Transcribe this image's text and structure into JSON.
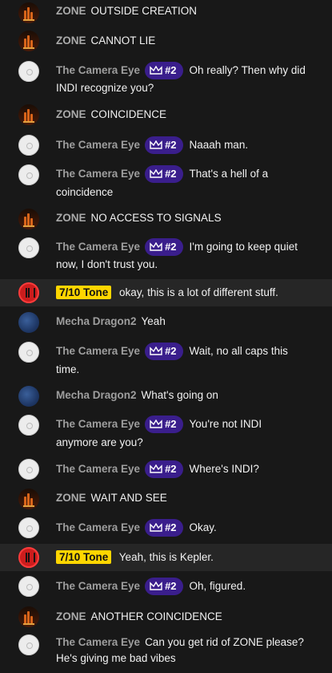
{
  "messages": [
    {
      "author": "ZONE",
      "avatar": "zone-avatar",
      "text": "OUTSIDE CREATION"
    },
    {
      "author": "ZONE",
      "avatar": "zone-avatar",
      "text": "CANNOT LIE"
    },
    {
      "author": "The Camera Eye",
      "avatar": "camera-eye-avatar",
      "badge": "#2",
      "text": "Oh really? Then why did",
      "text2": "INDI recognize you?"
    },
    {
      "author": "ZONE",
      "avatar": "zone-avatar",
      "text": "COINCIDENCE"
    },
    {
      "author": "The Camera Eye",
      "avatar": "camera-eye-avatar",
      "badge": "#2",
      "text": "Naaah man."
    },
    {
      "author": "The Camera Eye",
      "avatar": "camera-eye-avatar",
      "badge": "#2",
      "text": "That's a hell of a",
      "text2": "coincidence"
    },
    {
      "author": "ZONE",
      "avatar": "zone-avatar",
      "text": "NO ACCESS TO SIGNALS"
    },
    {
      "author": "The Camera Eye",
      "avatar": "camera-eye-avatar",
      "badge": "#2",
      "text": "I'm going to keep quiet",
      "text2": "now, I don't trust you."
    },
    {
      "author": "7/10 Tone",
      "avatar": "tone-avatar",
      "text": "okay, this is a lot of different stuff."
    },
    {
      "author": "Mecha Dragon2",
      "avatar": "mecha-dragon-avatar",
      "text": "Yeah"
    },
    {
      "author": "The Camera Eye",
      "avatar": "camera-eye-avatar",
      "badge": "#2",
      "text": "Wait, no all caps this",
      "text2": "time."
    },
    {
      "author": "Mecha Dragon2",
      "avatar": "mecha-dragon-avatar",
      "text": "What's going on"
    },
    {
      "author": "The Camera Eye",
      "avatar": "camera-eye-avatar",
      "badge": "#2",
      "text": "You're not INDI",
      "text2": "anymore are you?"
    },
    {
      "author": "The Camera Eye",
      "avatar": "camera-eye-avatar",
      "badge": "#2",
      "text": "Where's INDI?"
    },
    {
      "author": "ZONE",
      "avatar": "zone-avatar",
      "text": "WAIT AND SEE"
    },
    {
      "author": "The Camera Eye",
      "avatar": "camera-eye-avatar",
      "badge": "#2",
      "text": "Okay."
    },
    {
      "author": "7/10 Tone",
      "avatar": "tone-avatar",
      "text": "Yeah, this is Kepler."
    },
    {
      "author": "The Camera Eye",
      "avatar": "camera-eye-avatar",
      "badge": "#2",
      "text": "Oh, figured."
    },
    {
      "author": "ZONE",
      "avatar": "zone-avatar",
      "text": "ANOTHER COINCIDENCE"
    },
    {
      "author": "The Camera Eye",
      "avatar": "camera-eye-avatar",
      "text": "Can you get rid of ZONE please?",
      "text2": "He's giving me bad vibes"
    }
  ],
  "colors": {
    "background": "#181818",
    "highlight_row": "#262626",
    "member_badge": "#3a1e8c",
    "owner_name_bg": "#ffd600"
  }
}
